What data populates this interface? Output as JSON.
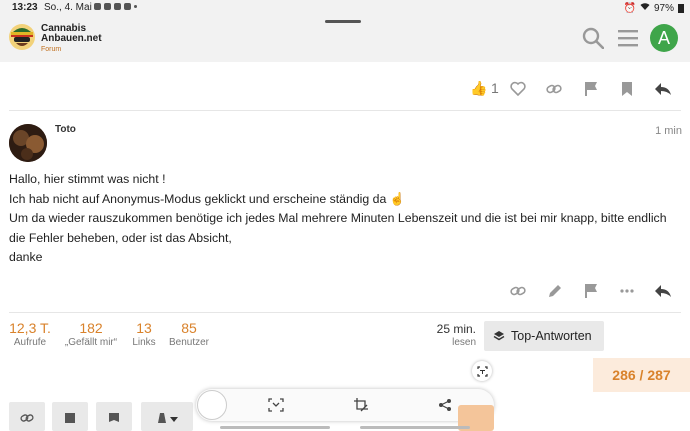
{
  "status_bar": {
    "time": "13:23",
    "date": "So., 4. Mai",
    "battery": "97%"
  },
  "header": {
    "brand_line1": "Cannabis",
    "brand_line2": "Anbauen.net",
    "brand_line3": "Forum",
    "avatar_letter": "A"
  },
  "post_actions_top": {
    "like_count": "1"
  },
  "post": {
    "username": "Toto",
    "time": "1 min",
    "lines": [
      "Hallo, hier stimmt was nicht !",
      "Ich hab nicht auf Anonymus-Modus geklickt und erscheine ständig da ☝️",
      "Um da wieder rauszukommen benötige ich jedes Mal mehrere Minuten Lebenszeit und die ist bei mir knapp, bitte endlich die Fehler beheben, oder ist das Absicht,",
      "danke"
    ]
  },
  "topic_stats": {
    "views_value": "12,3 T.",
    "views_label": "Aufrufe",
    "likes_value": "182",
    "likes_label": "„Gefällt mir“",
    "links_value": "13",
    "links_label": "Links",
    "users_value": "85",
    "users_label": "Benutzer",
    "read_value": "25 min.",
    "read_label": "lesen",
    "top_answers_label": "Top-Antworten"
  },
  "progress": "286 / 287",
  "colors": {
    "accent": "#d9822b",
    "avatar": "#3fa54a",
    "progress_bg": "#fcebdc"
  }
}
